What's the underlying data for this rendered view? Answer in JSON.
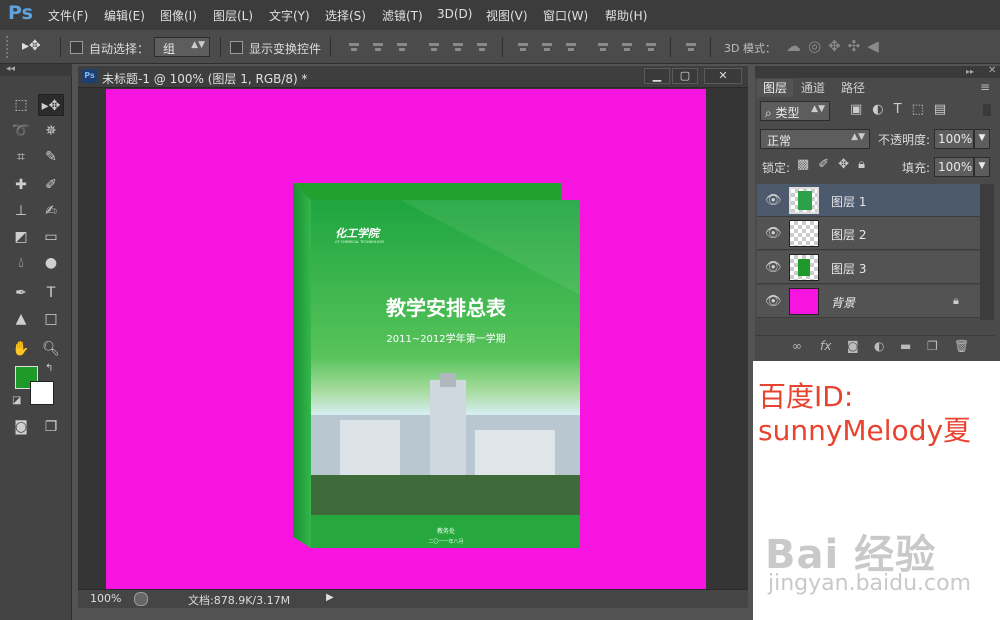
{
  "app": {
    "logo": "Ps"
  },
  "menu": [
    "文件(F)",
    "编辑(E)",
    "图像(I)",
    "图层(L)",
    "文字(Y)",
    "选择(S)",
    "滤镜(T)",
    "3D(D)",
    "视图(V)",
    "窗口(W)",
    "帮助(H)"
  ],
  "options": {
    "auto_select_label": "自动选择：",
    "auto_select_value": "组",
    "show_transform_label": "显示变换控件",
    "mode_3d_label": "3D 模式："
  },
  "document": {
    "title": "未标题-1 @ 100% (图层 1, RGB/8) *",
    "zoom": "100%",
    "doc_info": "文档:878.9K/3.17M",
    "canvas_color": "#f714e1"
  },
  "artwork": {
    "school_logo": "化工学院",
    "school_en": "OF CHEMICAL TECHNOLOGY",
    "title": "教学安排总表",
    "subtitle": "2011~2012学年第一学期",
    "footer_dept": "教务处",
    "footer_date": "二〇一一年八月"
  },
  "layers_panel": {
    "tabs": [
      "图层",
      "通道",
      "路径"
    ],
    "filter_label": "类型",
    "blend_mode": "正常",
    "opacity_label": "不透明度:",
    "opacity_value": "100%",
    "lock_label": "锁定:",
    "fill_label": "填充:",
    "fill_value": "100%",
    "layers": [
      {
        "name": "图层 1",
        "selected": true
      },
      {
        "name": "图层 2",
        "selected": false
      },
      {
        "name": "图层 3",
        "selected": false
      },
      {
        "name": "背景",
        "selected": false,
        "locked": true
      }
    ]
  },
  "watermark": {
    "line1": "百度ID:",
    "line2": "sunnyMelody夏",
    "logo": "Bai 经验",
    "url": "jingyan.baidu.com"
  }
}
